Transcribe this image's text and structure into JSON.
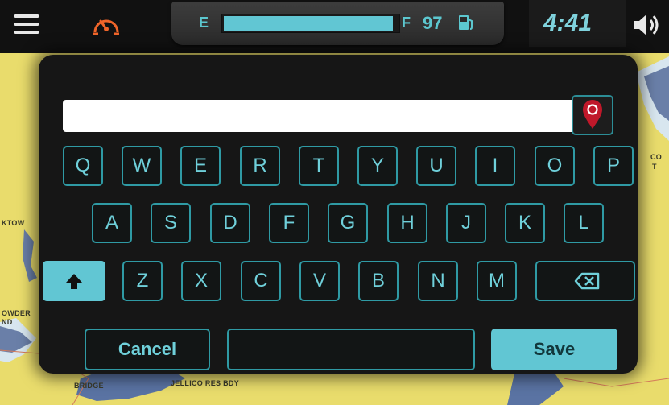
{
  "topbar": {
    "menu_icon": "hamburger-menu-icon",
    "speed_icon": "speedometer-icon",
    "fuel": {
      "empty_label": "E",
      "full_label": "F",
      "level": "97",
      "level_fraction": 0.97,
      "pump_icon": "fuel-pump-icon"
    },
    "clock": "4:41",
    "volume_icon": "volume-icon"
  },
  "map": {
    "labels": [
      "KTOW",
      "OWDER",
      "ND",
      "BRIDGE",
      "JELLICO RES BDY",
      "CO",
      "T"
    ]
  },
  "keyboard": {
    "search_value": "",
    "location_icon": "location-pin-icon",
    "rows": [
      [
        "Q",
        "W",
        "E",
        "R",
        "T",
        "Y",
        "U",
        "I",
        "O",
        "P"
      ],
      [
        "A",
        "S",
        "D",
        "F",
        "G",
        "H",
        "J",
        "K",
        "L"
      ],
      [
        "Z",
        "X",
        "C",
        "V",
        "B",
        "N",
        "M"
      ]
    ],
    "shift_icon": "shift-arrow-icon",
    "backspace_icon": "backspace-icon",
    "cancel_label": "Cancel",
    "save_label": "Save"
  },
  "colors": {
    "accent": "#61c6d3",
    "key_border": "#2f9aa4",
    "panel": "#161616",
    "map": "#e9dc6c",
    "pin": "#c0182a",
    "speed_icon": "#f0652a"
  }
}
